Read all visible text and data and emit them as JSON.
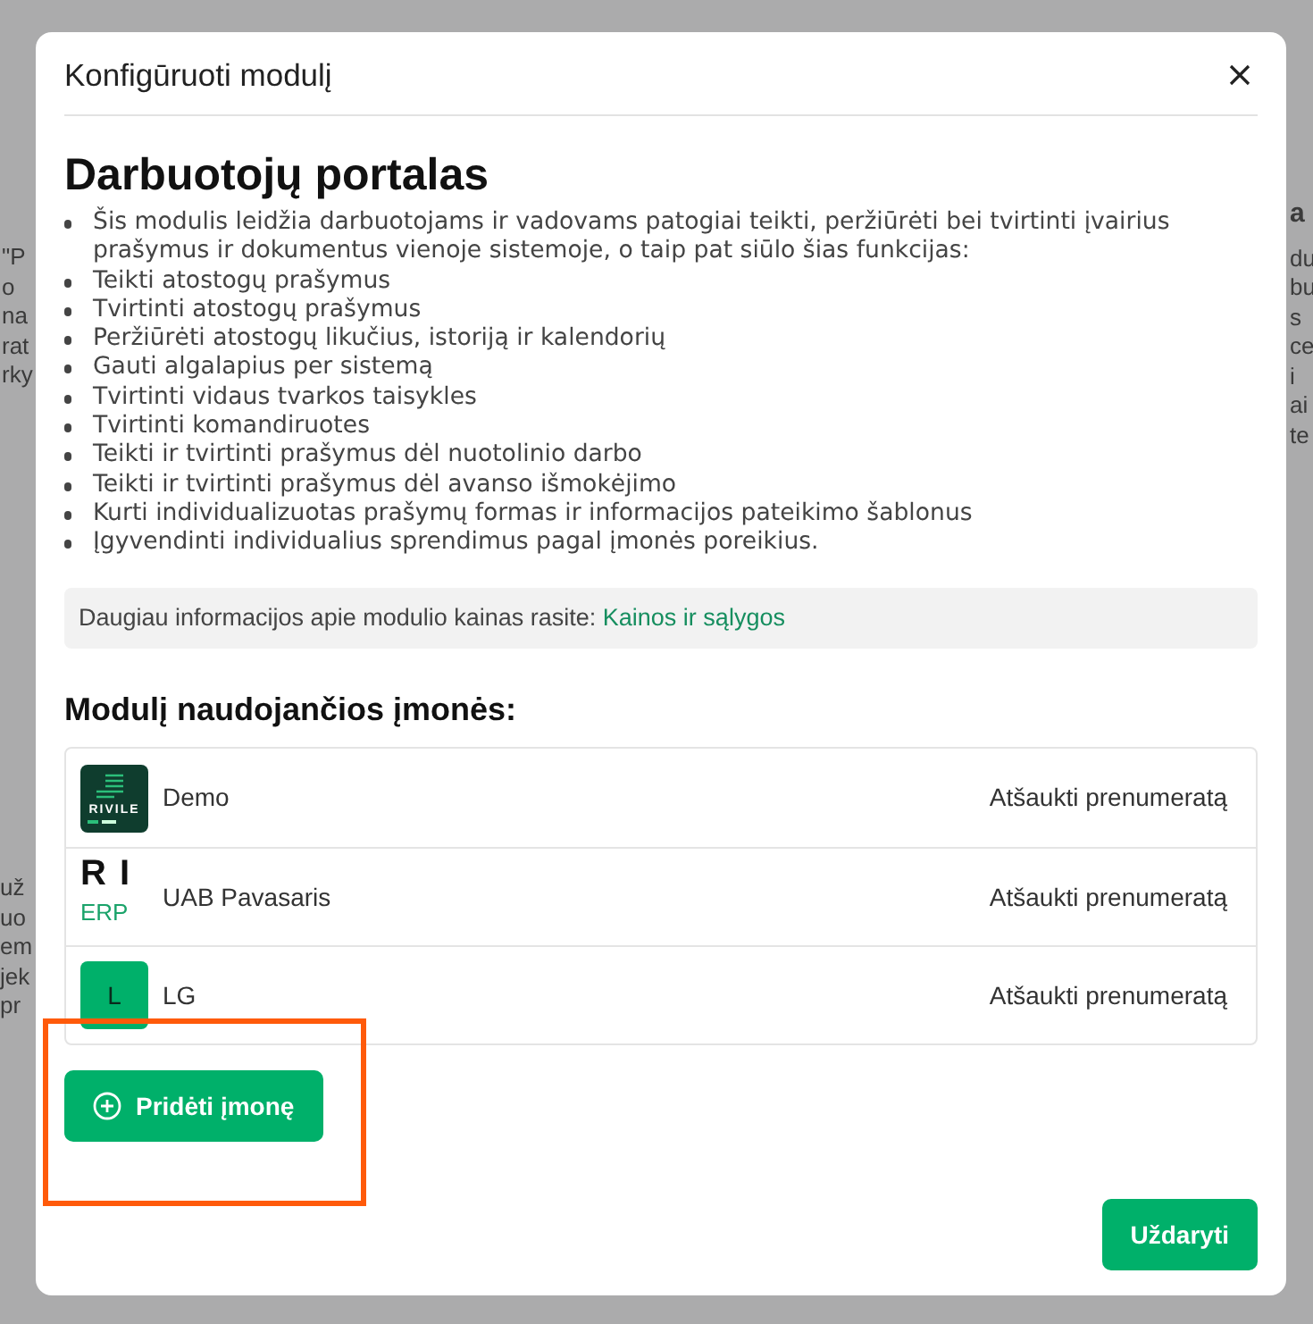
{
  "background": {
    "left_fragments": [
      "\"P",
      "o",
      "na",
      "rat",
      "rky"
    ],
    "right_fragments": [
      "a",
      "du",
      "bu",
      "s",
      "ce",
      "i",
      "ai",
      "te"
    ],
    "lower_left_fragments": [
      "už",
      "uo",
      "em",
      "jek",
      "pr"
    ]
  },
  "modal": {
    "title": "Konfigūruoti modulį",
    "heading": "Darbuotojų portalas",
    "items": [
      "Šis modulis leidžia darbuotojams ir vadovams patogiai teikti, peržiūrėti bei tvirtinti įvairius prašymus ir dokumentus vienoje sistemoje, o taip pat siūlo šias funkcijas:",
      "Teikti atostogų prašymus",
      "Tvirtinti atostogų prašymus",
      "Peržiūrėti atostogų likučius, istoriją ir kalendorių",
      "Gauti algalapius per sistemą",
      "Tvirtinti vidaus tvarkos taisykles",
      "Tvirtinti komandiruotes",
      "Teikti ir tvirtinti prašymus dėl nuotolinio darbo",
      "Teikti ir tvirtinti prašymus dėl avanso išmokėjimo",
      "Kurti individualizuotas prašymų formas ir informacijos pateikimo šablonus",
      "Įgyvendinti individualius sprendimus pagal įmonės poreikius."
    ],
    "info": {
      "text": "Daugiau informacijos apie modulio kainas rasite:",
      "link": "Kainos ir sąlygos"
    },
    "companies_heading": "Modulį naudojančios įmonės:",
    "companies": [
      {
        "kind": "badge",
        "logo_text": "RIVILE",
        "name": "Demo",
        "action": "Atšaukti prenumeratą"
      },
      {
        "kind": "wordmark",
        "logo_text": "R I",
        "logo_subtext": "ERP",
        "name": "UAB Pavasaris",
        "action": "Atšaukti prenumeratą"
      },
      {
        "kind": "letter",
        "logo_text": "L",
        "name": "LG",
        "action": "Atšaukti prenumeratą"
      }
    ],
    "add_button": "Pridėti įmonę",
    "close_button": "Uždaryti",
    "highlight": true
  }
}
